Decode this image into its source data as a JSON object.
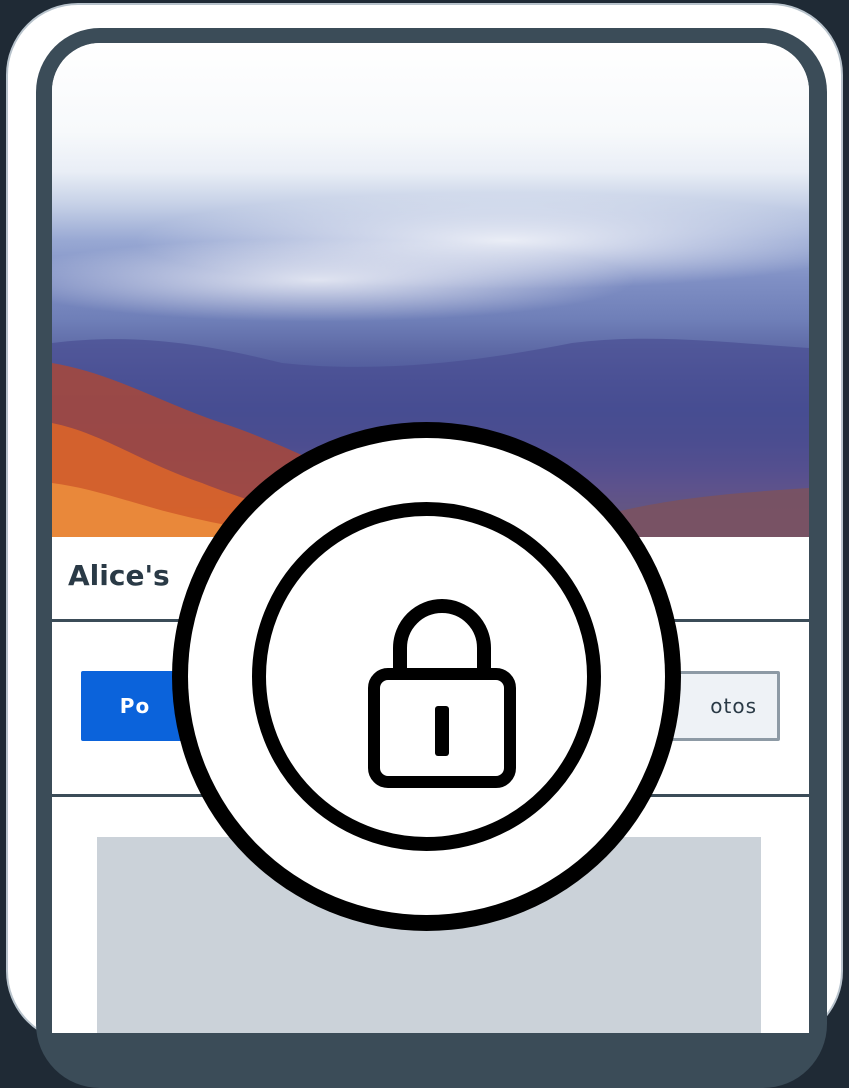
{
  "profile": {
    "title": "Alice's",
    "cover_image": "mountain-landscape-cover"
  },
  "tabs": [
    {
      "label": "Po",
      "active": true
    },
    {
      "label": "otos",
      "active": false
    }
  ],
  "overlay": {
    "icon": "lock-icon",
    "state": "locked"
  },
  "colors": {
    "active_tab": "#0b63db",
    "frame": "#3b4c58",
    "card": "#cbd2d9"
  }
}
